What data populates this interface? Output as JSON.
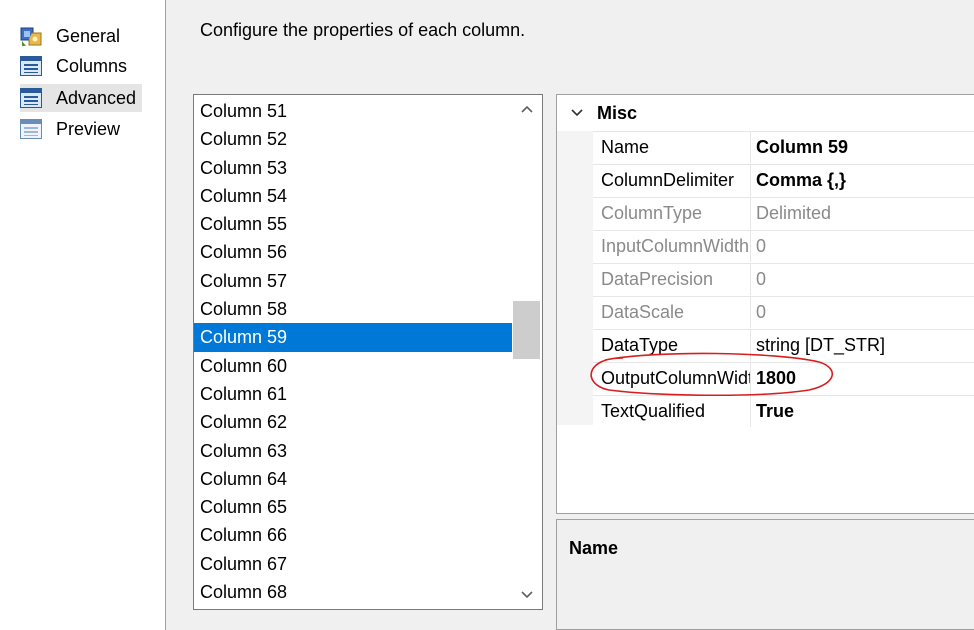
{
  "nav": {
    "items": [
      {
        "label": "General",
        "icon": "general-icon"
      },
      {
        "label": "Columns",
        "icon": "columns-icon"
      },
      {
        "label": "Advanced",
        "icon": "advanced-icon",
        "selected": true
      },
      {
        "label": "Preview",
        "icon": "preview-icon"
      }
    ]
  },
  "description": "Configure the properties of each column.",
  "column_list": {
    "items": [
      "Column 51",
      "Column 52",
      "Column 53",
      "Column 54",
      "Column 55",
      "Column 56",
      "Column 57",
      "Column 58",
      "Column 59",
      "Column 60",
      "Column 61",
      "Column 62",
      "Column 63",
      "Column 64",
      "Column 65",
      "Column 66",
      "Column 67",
      "Column 68"
    ],
    "selected": "Column 59",
    "scroll_up_glyph": "^",
    "scroll_down_glyph": "v"
  },
  "property_grid": {
    "chevron_glyph": "v",
    "category": "Misc",
    "rows": [
      {
        "name": "Name",
        "value": "Column 59",
        "readonly": false,
        "bold": true
      },
      {
        "name": "ColumnDelimiter",
        "value": "Comma {,}",
        "readonly": false,
        "bold": true
      },
      {
        "name": "ColumnType",
        "value": "Delimited",
        "readonly": true,
        "bold": false
      },
      {
        "name": "InputColumnWidth",
        "value": "0",
        "readonly": true,
        "bold": false
      },
      {
        "name": "DataPrecision",
        "value": "0",
        "readonly": true,
        "bold": false
      },
      {
        "name": "DataScale",
        "value": "0",
        "readonly": true,
        "bold": false
      },
      {
        "name": "DataType",
        "value": "string [DT_STR]",
        "readonly": false,
        "bold": false
      },
      {
        "name": "OutputColumnWidth",
        "value": "1800",
        "readonly": false,
        "bold": true
      },
      {
        "name": "TextQualified",
        "value": "True",
        "readonly": false,
        "bold": true
      }
    ]
  },
  "description_panel": {
    "title": "Name"
  },
  "colors": {
    "selection": "#0078d7",
    "annotation": "#d62020"
  }
}
